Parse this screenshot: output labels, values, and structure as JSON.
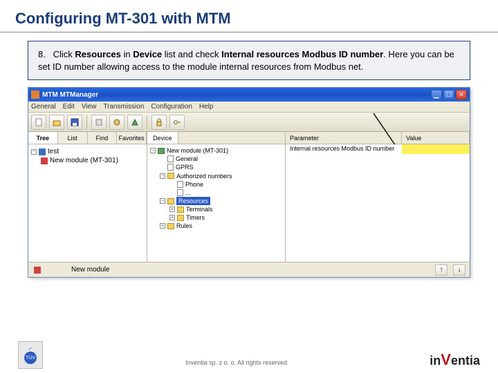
{
  "slide": {
    "title": "Configuring MT-301 with MTM",
    "step_number": "8.",
    "instruction_html": "Click <b>Resources</b> in <b>Device</b> list and check <b>Internal resources Modbus ID number</b>. Here you can be set ID number allowing access to the module internal resources from Modbus net."
  },
  "window": {
    "title": "MTM   MTManager",
    "menus": [
      "General",
      "Edit",
      "View",
      "Transmission",
      "Configuration",
      "Help"
    ],
    "left_tabs": [
      "Tree",
      "List",
      "Find",
      "Favorites"
    ],
    "left_tree_root": "test",
    "left_tree_item": "New module (MT-301)",
    "mid_tab": "Device",
    "device_tree": {
      "root": "New module (MT-301)",
      "general": "General",
      "gprs": "GPRS",
      "auth": "Authorized numbers",
      "phone": "Phone",
      "dots": "...",
      "resources": "Resources",
      "terminals": "Terminals",
      "timers": "Timers",
      "rules": "Rules"
    },
    "right_headers": {
      "param": "Parameter",
      "value": "Value"
    },
    "right_row": {
      "param": "Internal resources Modbus ID number",
      "value": ""
    },
    "status": "New module",
    "nav": {
      "up": "↑",
      "down": "↓"
    }
  },
  "footer": {
    "tuv_top": "✓",
    "tuv_label": "TÜV",
    "copyright": "Inventia sp. z o. o. All rights reserved",
    "logo_pre": "in",
    "logo_v": "V",
    "logo_post": "entia"
  }
}
